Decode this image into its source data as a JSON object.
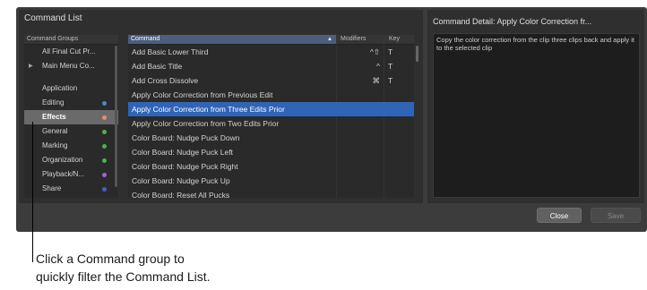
{
  "window": {
    "title": "Command List",
    "close_label": "Close",
    "save_label": "Save"
  },
  "groups": {
    "header": "Command Groups",
    "items": [
      {
        "label": "All Final Cut Pr...",
        "dot": null,
        "expandable": false,
        "selected": false
      },
      {
        "label": "Main Menu Co...",
        "dot": null,
        "expandable": true,
        "selected": false
      },
      {
        "label": "Application",
        "dot": null,
        "expandable": false,
        "selected": false
      },
      {
        "label": "Editing",
        "dot": "#4f86c6",
        "expandable": false,
        "selected": false
      },
      {
        "label": "Effects",
        "dot": "#e0906a",
        "expandable": false,
        "selected": true
      },
      {
        "label": "General",
        "dot": "#4ab34a",
        "expandable": false,
        "selected": false
      },
      {
        "label": "Marking",
        "dot": "#4ab34a",
        "expandable": false,
        "selected": false
      },
      {
        "label": "Organization",
        "dot": "#4ab34a",
        "expandable": false,
        "selected": false
      },
      {
        "label": "Playback/N...",
        "dot": "#9a6ac8",
        "expandable": false,
        "selected": false
      },
      {
        "label": "Share",
        "dot": "#4a5ec8",
        "expandable": false,
        "selected": false
      }
    ]
  },
  "commands": {
    "header_command": "Command",
    "header_modifiers": "Modifiers",
    "header_key": "Key",
    "rows": [
      {
        "name": "Add Basic Lower Third",
        "modifiers": "^⇧",
        "key": "T",
        "selected": false
      },
      {
        "name": "Add Basic Title",
        "modifiers": "^",
        "key": "T",
        "selected": false
      },
      {
        "name": "Add Cross Dissolve",
        "modifiers": "⌘",
        "key": "T",
        "selected": false
      },
      {
        "name": "Apply Color Correction from Previous Edit",
        "modifiers": "",
        "key": "",
        "selected": false
      },
      {
        "name": "Apply Color Correction from Three Edits Prior",
        "modifiers": "",
        "key": "",
        "selected": true
      },
      {
        "name": "Apply Color Correction from Two Edits Prior",
        "modifiers": "",
        "key": "",
        "selected": false
      },
      {
        "name": "Color Board: Nudge Puck Down",
        "modifiers": "",
        "key": "",
        "selected": false
      },
      {
        "name": "Color Board: Nudge Puck Left",
        "modifiers": "",
        "key": "",
        "selected": false
      },
      {
        "name": "Color Board: Nudge Puck Right",
        "modifiers": "",
        "key": "",
        "selected": false
      },
      {
        "name": "Color Board: Nudge Puck Up",
        "modifiers": "",
        "key": "",
        "selected": false
      },
      {
        "name": "Color Board: Reset All Pucks",
        "modifiers": "",
        "key": "",
        "selected": false
      }
    ]
  },
  "detail": {
    "title": "Command Detail: Apply Color Correction fr...",
    "body": "Copy the color correction from the clip three clips back and apply it to the selected clip"
  },
  "callout": {
    "line1": "Click a Command group to",
    "line2": "quickly filter the Command List."
  }
}
